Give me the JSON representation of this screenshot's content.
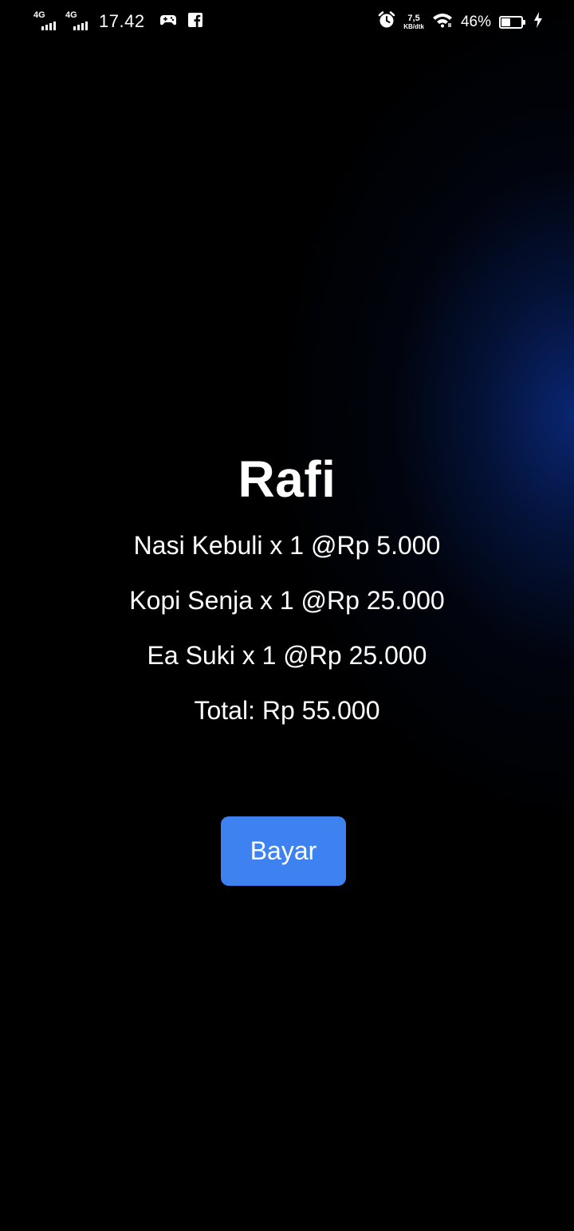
{
  "status_bar": {
    "network_1": "4G",
    "network_2": "4G",
    "time": "17.42",
    "net_speed_value": "7,5",
    "net_speed_unit": "KB/dtk",
    "battery_percent": "46%",
    "battery_level": 0.46,
    "icons": [
      "signal-icon",
      "signal-icon",
      "game-controller-icon",
      "facebook-icon",
      "alarm-icon",
      "wifi-icon",
      "battery-icon",
      "charging-icon"
    ]
  },
  "order": {
    "customer_name": "Rafi",
    "items": [
      {
        "text": "Nasi Kebuli x 1 @Rp 5.000"
      },
      {
        "text": "Kopi Senja x 1 @Rp 25.000"
      },
      {
        "text": "Ea Suki x 1 @Rp 25.000"
      }
    ],
    "total": "Total: Rp 55.000"
  },
  "actions": {
    "pay_label": "Bayar"
  },
  "colors": {
    "background": "#000000",
    "glow": "#0a2878",
    "button": "#3d82f0",
    "text": "#ffffff"
  }
}
